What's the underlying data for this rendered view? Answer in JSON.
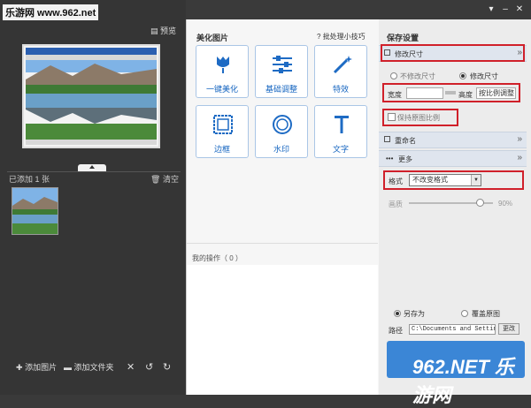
{
  "watermark_top": "乐游网 www.962.net",
  "left": {
    "preview_label": "预览",
    "added_count": "已添加 1 张",
    "clear_label": "清空",
    "bottom": {
      "add_image": "添加图片",
      "add_folder": "添加文件夹"
    }
  },
  "middle": {
    "title": "美化图片",
    "tips_link": "批处理小技巧",
    "tools": [
      {
        "label": "一键美化",
        "icon": "tulip-icon"
      },
      {
        "label": "基础调整",
        "icon": "sliders-icon"
      },
      {
        "label": "特效",
        "icon": "magic-wand-icon"
      },
      {
        "label": "边框",
        "icon": "frame-icon"
      },
      {
        "label": "水印",
        "icon": "watermark-icon"
      },
      {
        "label": "文字",
        "icon": "text-icon"
      }
    ],
    "ops_label": "我的操作（ 0 ）"
  },
  "right": {
    "title": "保存设置",
    "resize_header": "修改尺寸",
    "radio_keep": "不修改尺寸",
    "radio_change": "修改尺寸",
    "width_label": "宽度",
    "height_label": "高度",
    "ratio_button": "按比例调整",
    "keep_ratio": "保持原图比例",
    "rename_header": "重命名",
    "more_header": "更多",
    "format_label": "格式",
    "format_value": "不改变格式",
    "quality_label": "画质",
    "quality_value": "90%",
    "save_as": "另存为",
    "overwrite": "覆盖原图",
    "path_label": "路径",
    "path_value": "C:\\Documents and Settings\\",
    "change_button": "更改"
  },
  "watermark_bottom": "962.NET 乐游网",
  "colors": {
    "accent": "#1565c0",
    "highlight": "#d0202a",
    "save_button": "#3b86d6"
  }
}
